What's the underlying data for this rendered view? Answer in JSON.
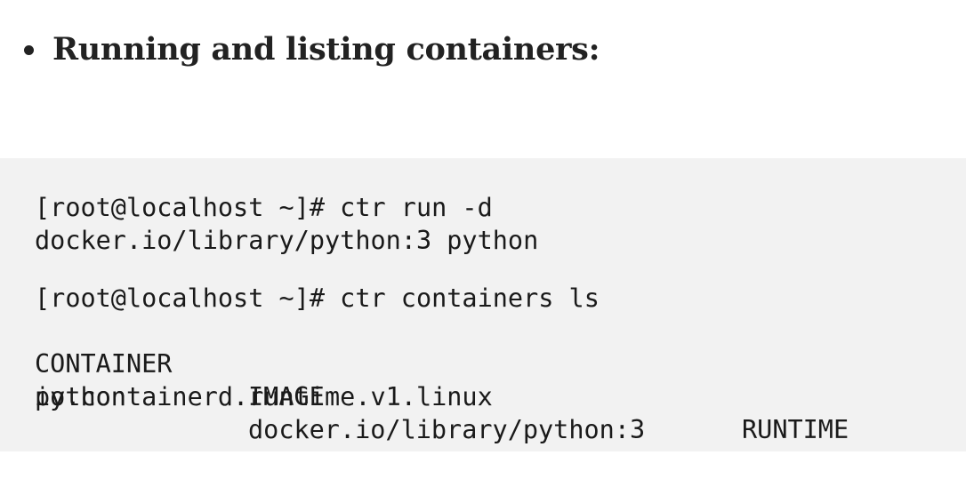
{
  "heading": {
    "text": "Running and listing containers:"
  },
  "code": {
    "command1_line1": "[root@localhost ~]# ctr run -d",
    "command1_line2": "docker.io/library/python:3 python",
    "command2_line1": "[root@localhost ~]# ctr containers ls",
    "table": {
      "headers": [
        "CONTAINER",
        "IMAGE",
        "RUNTIME"
      ],
      "row": {
        "container": "python",
        "image": "docker.io/library/python:3",
        "runtime": "io.containerd.runtime.v1.linux"
      }
    }
  }
}
